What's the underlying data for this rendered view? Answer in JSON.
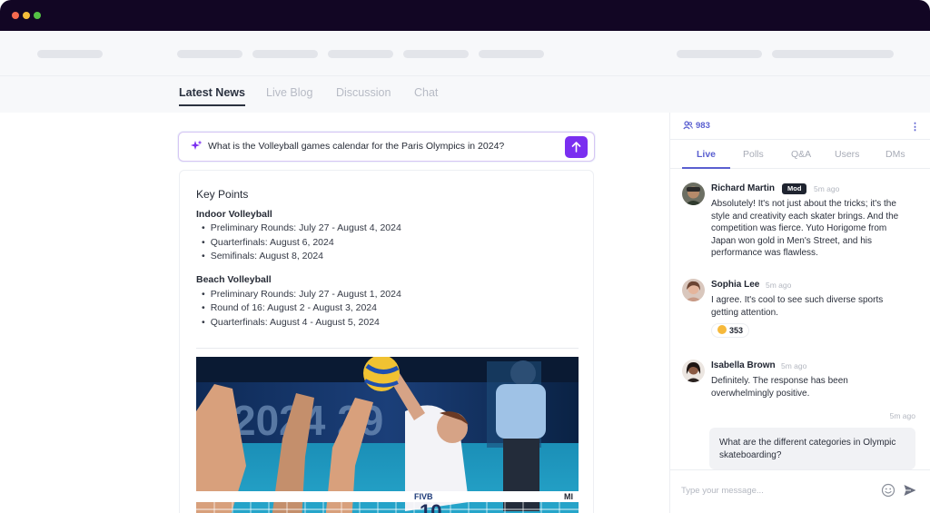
{
  "tabs": [
    {
      "label": "Latest News",
      "active": true
    },
    {
      "label": "Live Blog",
      "active": false
    },
    {
      "label": "Discussion",
      "active": false
    },
    {
      "label": "Chat",
      "active": false
    }
  ],
  "ask": {
    "question": "What is the Volleyball games calendar for the Paris Olympics in 2024?",
    "icon": "sparkle-icon",
    "submit_icon": "arrow-up-icon"
  },
  "answer": {
    "title": "Key Points",
    "sections": [
      {
        "heading": "Indoor Volleyball",
        "items": [
          "Preliminary Rounds: July 27 - August 4, 2024",
          "Quarterfinals: August 6, 2024",
          "Semifinals: August 8, 2024"
        ]
      },
      {
        "heading": "Beach Volleyball",
        "items": [
          "Preliminary Rounds: July 27 - August 1, 2024",
          "Round of 16: August 2 - August 3, 2024",
          "Quarterfinals: August 4 - August 5, 2024"
        ]
      }
    ],
    "photo": {
      "board_text": "2024 29",
      "net_logo": "FIVB",
      "jersey_number": "10"
    }
  },
  "chat": {
    "viewer_count": "983",
    "tabs": [
      {
        "label": "Live",
        "active": true
      },
      {
        "label": "Polls",
        "active": false
      },
      {
        "label": "Q&A",
        "active": false
      },
      {
        "label": "Users",
        "active": false
      },
      {
        "label": "DMs",
        "active": false
      }
    ],
    "messages": [
      {
        "name": "Richard Martin",
        "badge": "Mod",
        "time": "5m ago",
        "text": "Absolutely! It's not just about the tricks; it's the style and creativity each skater brings. And the competition was fierce. Yuto Horigome from Japan won gold in Men's Street, and his performance was flawless."
      },
      {
        "name": "Sophia Lee",
        "time": "5m ago",
        "text": "I agree. It's cool to see such diverse sports getting attention.",
        "reaction_count": "353"
      },
      {
        "name": "Isabella Brown",
        "time": "5m ago",
        "text": "Definitely. The response has been overwhelmingly positive."
      }
    ],
    "own_message": {
      "time": "5m ago",
      "text": "What are the different categories in Olympic skateboarding?"
    },
    "composer_placeholder": "Type your message..."
  },
  "colors": {
    "accent": "#7a2ff0",
    "chat_accent": "#5a5fd0",
    "titlebar": "#120624"
  }
}
